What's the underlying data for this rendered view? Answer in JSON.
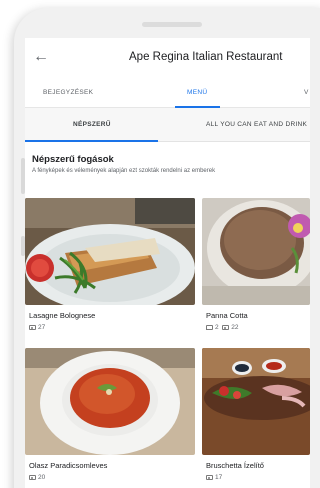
{
  "app": {
    "title": "Ape Regina Italian Restaurant",
    "back_icon": "arrow-back-icon"
  },
  "tabs": [
    {
      "label": "BEJEGYZÉSEK",
      "active": false
    },
    {
      "label": "MENÜ",
      "active": true
    },
    {
      "label": "V",
      "active": false
    }
  ],
  "subtabs": [
    {
      "label": "NÉPSZERŰ",
      "active": true
    },
    {
      "label": "ALL YOU CAN EAT AND DRINK",
      "active": false
    }
  ],
  "section": {
    "title": "Népszerű fogások",
    "subtitle": "A fényképek és vélemények alapján ezt szokták rendelni az emberek"
  },
  "dishes": [
    {
      "name": "Lasagne Bolognese",
      "photos": "27",
      "reviews": ""
    },
    {
      "name": "Panna Cotta",
      "reviews": "2",
      "photos": "22"
    },
    {
      "name": "Olasz Paradicsomleves",
      "photos": "20",
      "reviews": ""
    },
    {
      "name": "Bruschetta Ízelítő",
      "photos": "17",
      "reviews": ""
    }
  ],
  "colors": {
    "accent": "#1a73e8",
    "text": "#202124",
    "secondary_text": "#5f6368"
  }
}
